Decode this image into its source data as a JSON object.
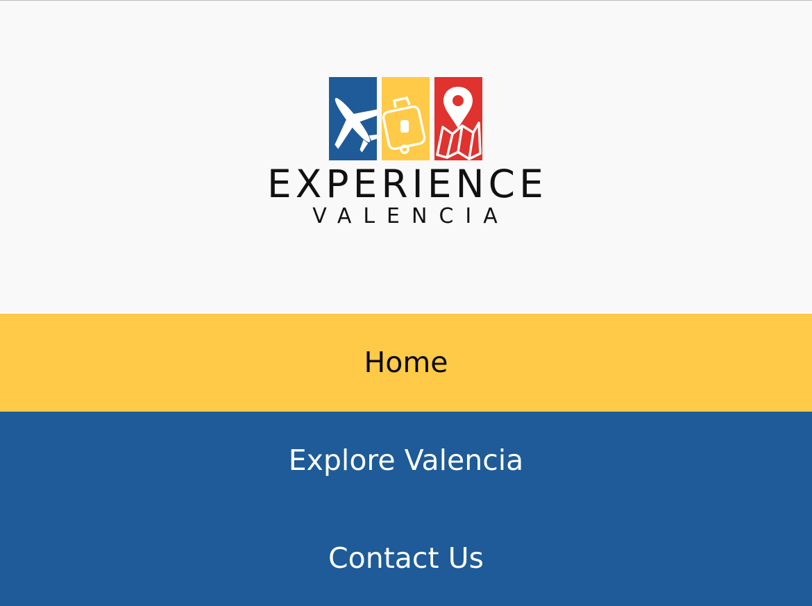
{
  "brand": {
    "line1": "EXPERIENCE",
    "line2": "VALENCIA",
    "icons": [
      "airplane-icon",
      "suitcase-icon",
      "map-pin-icon"
    ],
    "colors": {
      "blue": "#1e5b98",
      "yellow": "#ffca47",
      "red": "#e0322e"
    }
  },
  "nav": {
    "items": [
      {
        "label": "Home",
        "active": true
      },
      {
        "label": "Explore Valencia",
        "active": false
      },
      {
        "label": "Contact Us",
        "active": false
      }
    ]
  }
}
